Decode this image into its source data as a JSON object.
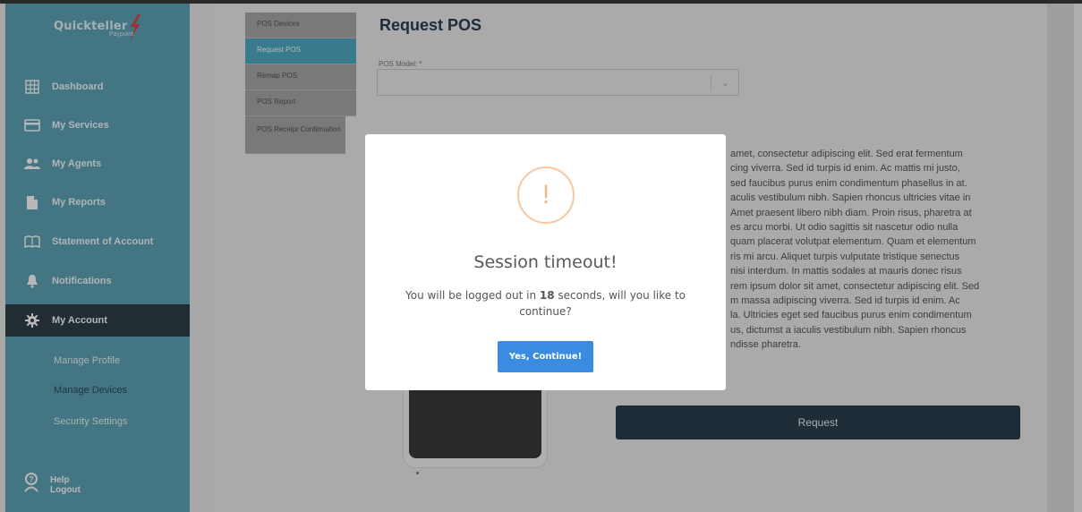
{
  "brand": {
    "name": "Quickteller",
    "sub": "Paypoint"
  },
  "sidebar": {
    "items": [
      {
        "label": "Dashboard",
        "icon": "grid-icon"
      },
      {
        "label": "My Services",
        "icon": "credit-card-icon"
      },
      {
        "label": "My Agents",
        "icon": "people-icon"
      },
      {
        "label": "My Reports",
        "icon": "document-icon"
      },
      {
        "label": "Statement of Account",
        "icon": "book-icon"
      },
      {
        "label": "Notifications",
        "icon": "bell-icon"
      },
      {
        "label": "My Account",
        "icon": "gear-icon",
        "active": true
      }
    ],
    "sub_items": [
      {
        "label": "Manage Profile"
      },
      {
        "label": "Manage Devices",
        "active": true
      },
      {
        "label": "Security Settings"
      }
    ],
    "help": {
      "label": "Help",
      "logout": "Logout",
      "icon": "help-icon"
    }
  },
  "pos_tabs": [
    {
      "label": "POS Devices"
    },
    {
      "label": "Request POS",
      "active": true
    },
    {
      "label": "Remap POS"
    },
    {
      "label": "POS Report"
    },
    {
      "label": "POS Receipt Confirmation"
    }
  ],
  "main": {
    "title": "Request POS",
    "model_label": "POS Model: *",
    "model_value": "",
    "body_lines": [
      "amet, consectetur adipiscing elit. Sed erat fermentum",
      "cing viverra. Sed id turpis id enim. Ac mattis mi justo,",
      "sed faucibus purus enim condimentum phasellus in at.",
      "aculis vestibulum nibh. Sapien rhoncus ultricies vitae in",
      "Amet praesent libero nibh diam. Proin risus, pharetra at",
      "es arcu morbi. Ut odio sagittis sit nascetur odio nulla",
      "quam placerat volutpat elementum. Quam et elementum",
      "ris mi arcu. Aliquet turpis vulputate tristique senectus",
      "nisi interdum. In mattis sodales at mauris donec risus",
      "rem ipsum dolor sit amet, consectetur adipiscing elit. Sed",
      "m massa adipiscing viverra. Sed id turpis id enim. Ac",
      "la. Ultricies eget sed faucibus purus enim condimentum",
      "us, dictumst a iaculis vestibulum nibh. Sapien rhoncus",
      "ndisse pharetra."
    ],
    "request_label": "Request"
  },
  "modal": {
    "icon": "!",
    "title": "Session timeout!",
    "text_before": "You will be logged out in ",
    "seconds": "18",
    "text_after": " seconds, will you like to continue?",
    "button_label": "Yes, Continue!"
  },
  "colors": {
    "sidebar": "#5da3b6",
    "active_nav": "#2f3d47",
    "primary_button": "#3b8ce0",
    "request_button": "#2a3d4d",
    "warning": "#f1b98a"
  }
}
